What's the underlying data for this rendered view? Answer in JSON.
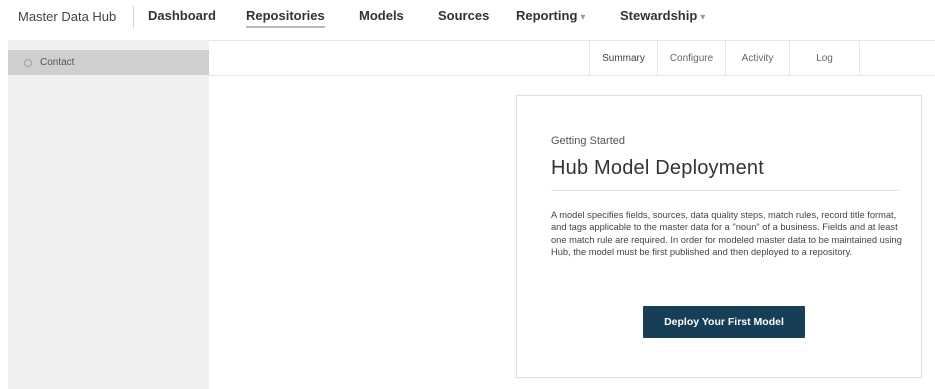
{
  "app": {
    "brand": "Master Data Hub"
  },
  "nav": {
    "items": [
      {
        "label": "Dashboard",
        "caret": ""
      },
      {
        "label": "Repositories",
        "caret": ""
      },
      {
        "label": "Models",
        "caret": ""
      },
      {
        "label": "Sources",
        "caret": ""
      },
      {
        "label": "Reporting",
        "caret": "▾"
      },
      {
        "label": "Stewardship",
        "caret": "▾"
      }
    ],
    "active": "Repositories"
  },
  "sidebar": {
    "items": [
      {
        "label": "Contact",
        "icon": "circle-icon"
      }
    ]
  },
  "tabs": [
    {
      "label": "Summary"
    },
    {
      "label": "Configure"
    },
    {
      "label": "Activity"
    },
    {
      "label": "Log"
    }
  ],
  "active_tab": "Summary",
  "card": {
    "eyebrow": "Getting Started",
    "title": "Hub Model Deployment",
    "body": "A model specifies fields, sources, data quality steps, match rules, record title format, and tags applicable to the master data for a \"noun\" of a business. Fields and at least one match rule are required. In order for modeled master data to be maintained using Hub, the model must be first published and then deployed to a repository.",
    "button_label": "Deploy Your First Model",
    "button_color": "#173e57"
  }
}
